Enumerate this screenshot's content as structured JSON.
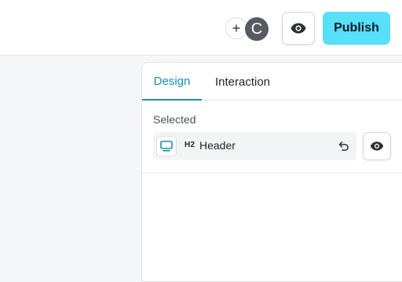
{
  "header": {
    "add_collaborator_symbol": "+",
    "avatar_initial": "C",
    "preview_icon": "eye-icon",
    "publish_label": "Publish",
    "publish_color": "#58dffa"
  },
  "panel": {
    "tabs": [
      {
        "label": "Design",
        "active": true
      },
      {
        "label": "Interaction",
        "active": false
      }
    ],
    "accent_color": "#1a8fb4",
    "section_label": "Selected",
    "selected_element": {
      "icon": "monitor-icon",
      "tag": "H2",
      "name": "Header",
      "revert_icon": "undo-icon",
      "visibility_icon": "eye-icon"
    }
  }
}
